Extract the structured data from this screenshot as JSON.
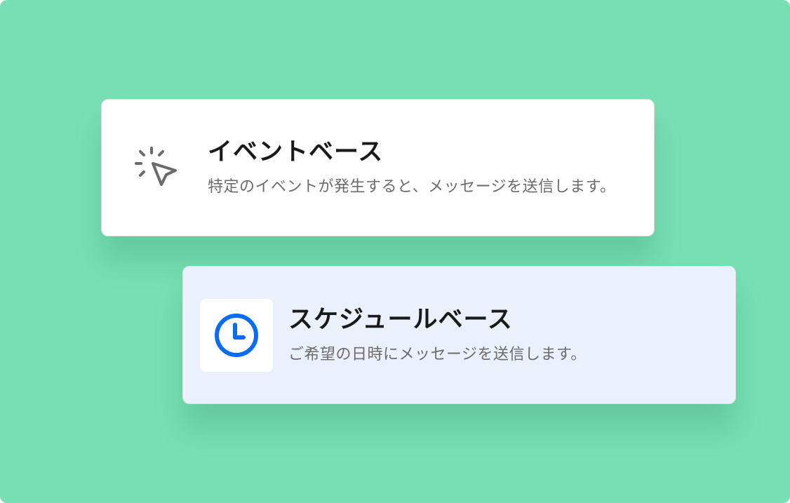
{
  "cards": [
    {
      "icon": "cursor-click-icon",
      "title": "イベントベース",
      "description": "特定のイベントが発生すると、メッセージを送信します。"
    },
    {
      "icon": "clock-icon",
      "title": "スケジュールベース",
      "description": "ご希望の日時にメッセージを送信します。"
    }
  ],
  "colors": {
    "background": "#77dfb3",
    "event_card": "#ffffff",
    "schedule_card": "#ebf1fc",
    "clock_accent": "#0a6cf2",
    "cursor_icon": "#6b6b6b"
  }
}
